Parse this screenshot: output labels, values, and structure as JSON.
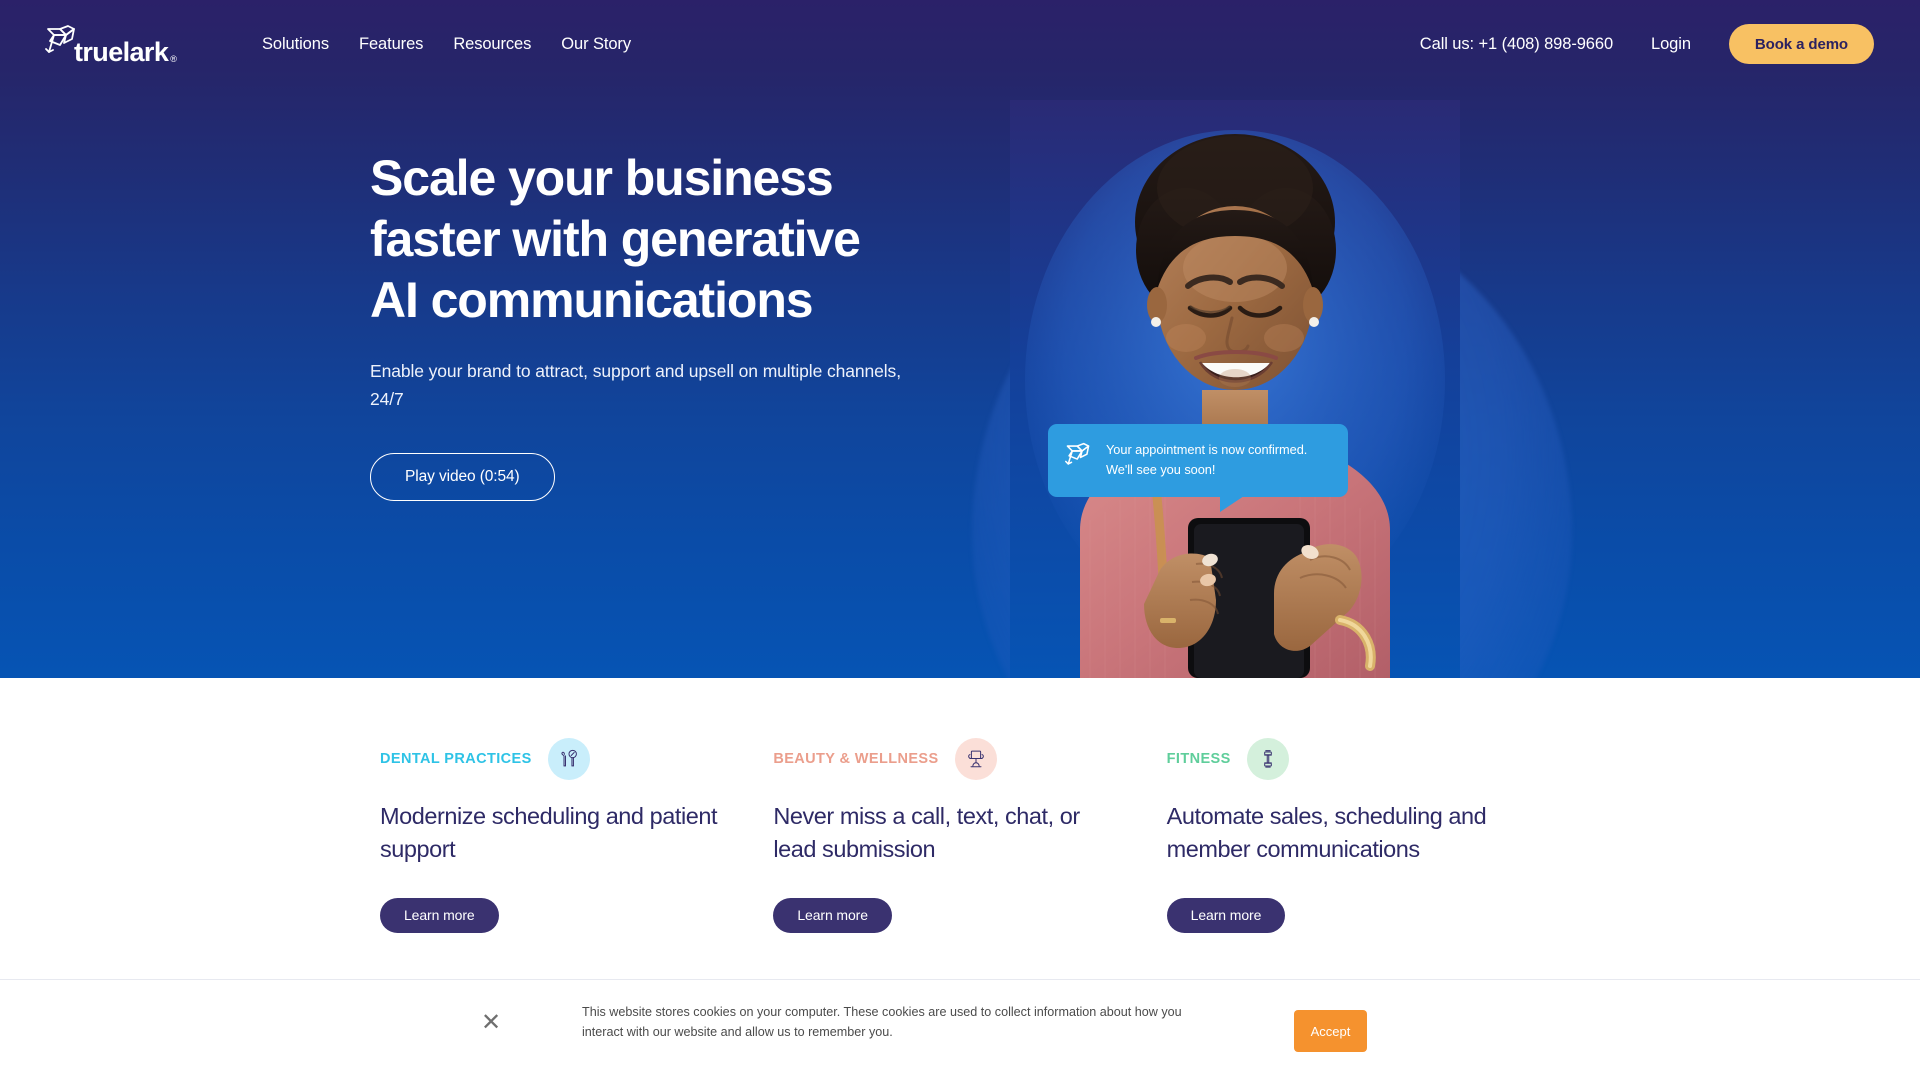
{
  "brand": {
    "name": "truelark",
    "registered_mark": "®",
    "logo_icon": "lark-bird-icon"
  },
  "nav": {
    "links": [
      {
        "label": "Solutions",
        "name": "nav-link-solutions"
      },
      {
        "label": "Features",
        "name": "nav-link-features"
      },
      {
        "label": "Resources",
        "name": "nav-link-resources"
      },
      {
        "label": "Our Story",
        "name": "nav-link-our-story"
      }
    ],
    "phone": "Call us: +1 (408) 898-9660",
    "login": "Login",
    "demo_button": "Book a demo"
  },
  "hero": {
    "title_line1": "Scale your business",
    "title_line2": "faster with generative",
    "title_line3": "AI communications",
    "subtitle": "Enable your brand to attract, support and upsell on multiple channels, 24/7",
    "play_button": "Play video (0:54)",
    "bubble": {
      "line1": "Your appointment is now confirmed.",
      "line2": "We'll see you soon!",
      "icon": "lark-bird-icon"
    },
    "photo_alt": "smiling-woman-with-phone"
  },
  "cards": [
    {
      "eyebrow": "DENTAL PRACTICES",
      "eyebrow_color": "#2ec3e6",
      "circle_color": "#c9eefb",
      "icon": "dental-tools-icon",
      "title": "Modernize scheduling and patient support",
      "cta": "Learn more"
    },
    {
      "eyebrow": "BEAUTY & WELLNESS",
      "eyebrow_color": "#eb9e8c",
      "circle_color": "#fbdfd8",
      "icon": "salon-chair-icon",
      "title": "Never miss a call, text, chat, or lead submission",
      "cta": "Learn more"
    },
    {
      "eyebrow": "FITNESS",
      "eyebrow_color": "#5fce9b",
      "circle_color": "#d4f0dc",
      "icon": "dumbbell-icon",
      "title": "Automate sales, scheduling and member communications",
      "cta": "Learn more"
    }
  ],
  "cookie": {
    "message": "This website stores cookies on your computer. These cookies are used to collect information about how you interact with our website and allow us to remember you.",
    "accept": "Accept",
    "close_icon": "close-icon"
  },
  "colors": {
    "hero_gradient_top": "#2b2169",
    "hero_gradient_bottom": "#0654b4",
    "demo_button": "#f8c163",
    "learn_more_button": "#3a3270",
    "accept_button": "#f5922e",
    "bubble": "#2e9ce0",
    "card_title": "#2e2a66"
  }
}
